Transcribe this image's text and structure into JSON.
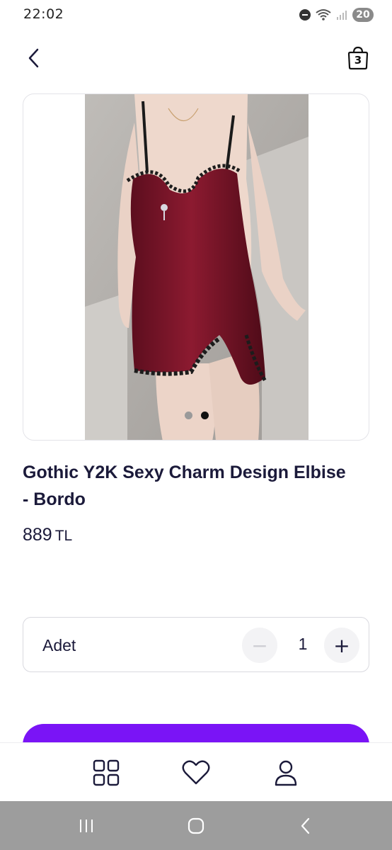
{
  "status_bar": {
    "time": "22:02",
    "battery": "20",
    "icons": [
      "dnd-icon",
      "wifi-icon",
      "signal-icon",
      "battery-icon"
    ]
  },
  "header": {
    "back_icon": "chevron-left-icon",
    "cart_icon": "shopping-bag-icon",
    "cart_count": "3"
  },
  "gallery": {
    "image_alt": "product-photo",
    "dots": 2,
    "active_dot": 1
  },
  "product": {
    "title": "Gothic Y2K Sexy Charm Design Elbise - Bordo",
    "price": "889",
    "currency": "TL"
  },
  "quantity": {
    "label": "Adet",
    "value": "1",
    "minus": "−",
    "plus": "+"
  },
  "add_to_cart": {
    "label": ""
  },
  "bottom_nav": {
    "items": [
      {
        "icon": "categories-icon"
      },
      {
        "icon": "heart-icon"
      },
      {
        "icon": "user-icon"
      }
    ]
  },
  "system_nav": {
    "recents_icon": "recents-icon",
    "home_icon": "home-icon",
    "back_icon": "back-icon"
  },
  "colors": {
    "accent": "#7a14f6",
    "text": "#1b1a3a",
    "dress": "#7a1428"
  }
}
